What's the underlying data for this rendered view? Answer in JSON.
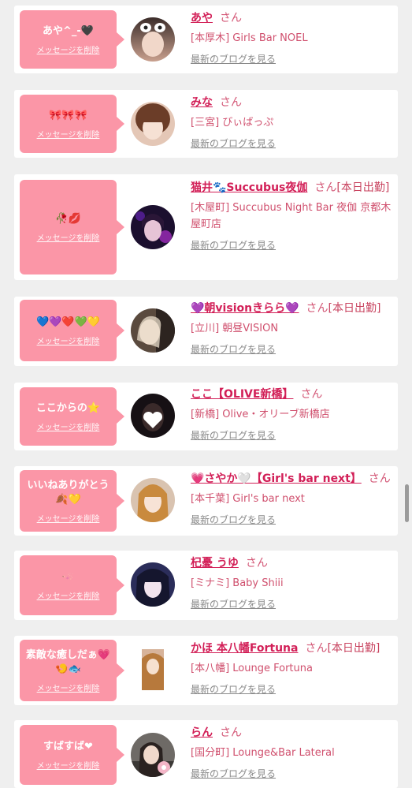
{
  "delete_label": "メッセージを削除",
  "blog_label": "最新のブログを見る",
  "san_label": "さん",
  "cards": [
    {
      "message": "あや^_-🖤",
      "name": "あや",
      "suffix": "",
      "shop": "[本厚木] Girls Bar NOEL",
      "avatar": "avatar-aya"
    },
    {
      "message": "🎀🎀🎀",
      "name": "みな",
      "suffix": "",
      "shop": "[三宮] びぃばっぷ",
      "avatar": "avatar-mina"
    },
    {
      "message": "🥀💋",
      "name": "猫井🐾Succubus夜伽",
      "suffix": "[本日出勤]",
      "shop": "[木屋町] Succubus Night Bar 夜伽 京都木屋町店",
      "avatar": "avatar-succubus"
    },
    {
      "message": "💙💜❤️💚💛",
      "name": "💜朝visionきらら💜",
      "suffix": "[本日出勤]",
      "shop": "[立川] 朝昼VISION",
      "avatar": "avatar-kirara"
    },
    {
      "message": "ここからの⭐",
      "name": "ここ【OLIVE新橋】",
      "suffix": "",
      "shop": "[新橋] Olive・オリーブ新橋店",
      "avatar": "avatar-koko"
    },
    {
      "message": "いいねありがとう🍂💛",
      "name": "💗さやか🤍【Girl's bar next】",
      "suffix": "",
      "shop": "[本千葉] Girl's bar next",
      "avatar": "avatar-sayaka"
    },
    {
      "message": "🪱",
      "name": "杞憂 うゆ",
      "suffix": "",
      "shop": "[ミナミ] Baby Shiii",
      "avatar": "avatar-uyu"
    },
    {
      "message": "素敵な癒しだぁ💗🍤🐟",
      "name": "かほ 本八幡Fortuna",
      "suffix": "[本日出勤]",
      "shop": "[本八幡] Lounge Fortuna",
      "avatar": "avatar-kaho"
    },
    {
      "message": "すばすば❤",
      "name": "らん",
      "suffix": "",
      "shop": "[国分町] Lounge&Bar Lateral",
      "avatar": "avatar-ran"
    }
  ]
}
